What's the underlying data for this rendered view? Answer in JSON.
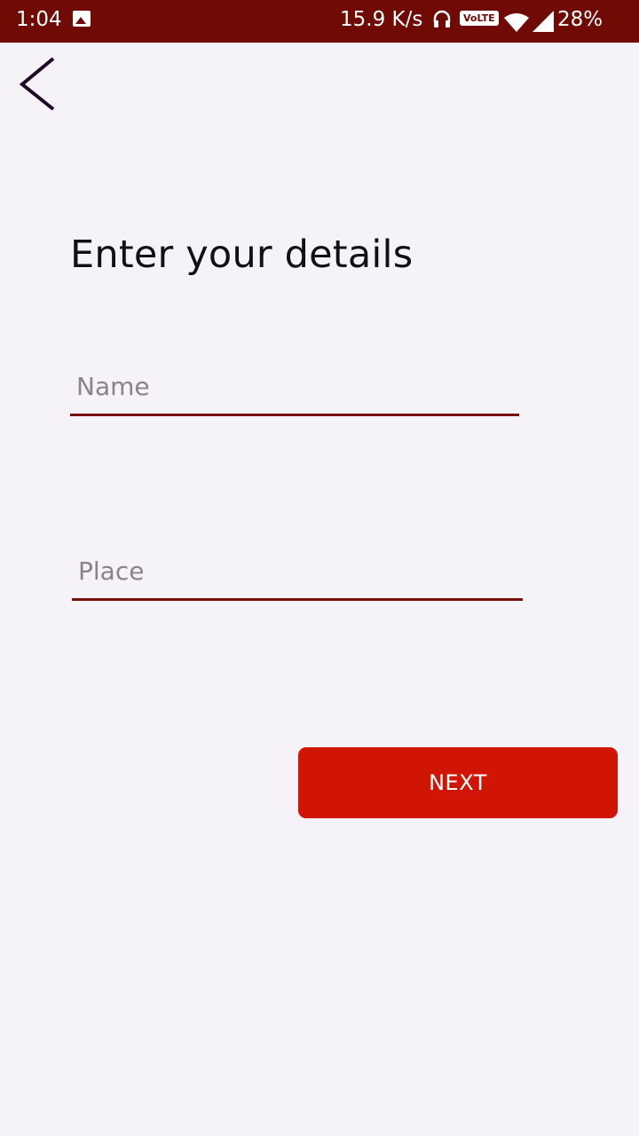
{
  "status_bar": {
    "time": "1:04",
    "network_speed": "15.9 K/s",
    "volte": "VoLTE",
    "battery": "28%",
    "icons": [
      "image-icon",
      "headset-icon",
      "volte-icon",
      "wifi-icon",
      "signal-icon"
    ]
  },
  "header": {
    "back_icon": "chevron-left-icon"
  },
  "form": {
    "title": "Enter your details",
    "name_placeholder": "Name",
    "name_value": "",
    "place_placeholder": "Place",
    "place_value": ""
  },
  "actions": {
    "next_label": "NEXT"
  },
  "colors": {
    "status_bar": "#700a05",
    "accent": "#d11505",
    "underline": "#7a0f0a",
    "background": "#f5f3f8"
  }
}
